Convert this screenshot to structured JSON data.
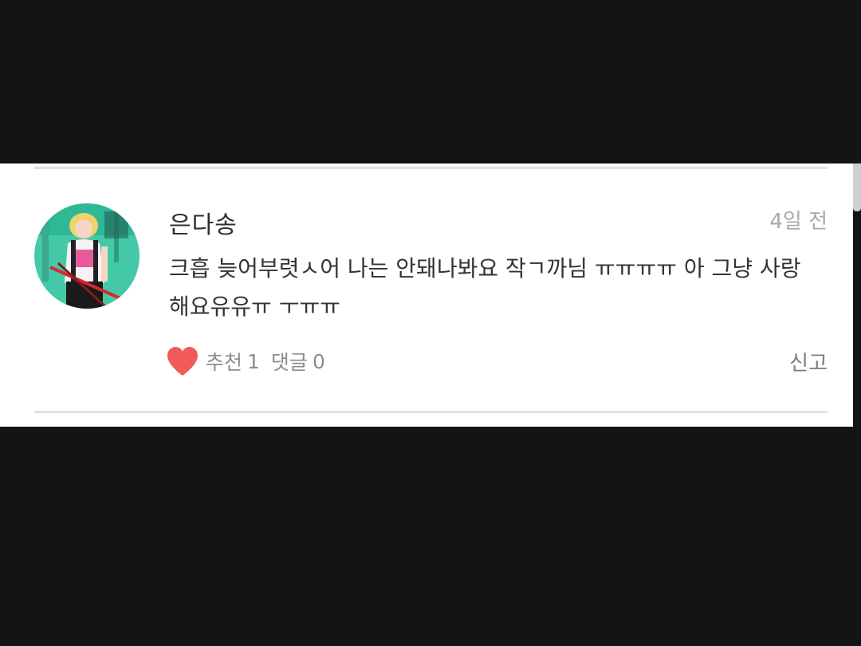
{
  "comment": {
    "username": "은다송",
    "timestamp": "4일 전",
    "text": "크흡 늦어부렷ㅅ어 나는 안돼나봐요 작ㄱ까님 ㅠㅠㅠㅠ 아 그냥 사랑해요유유ㅠ ㅜㅠㅠ",
    "avatar_icon": "user-avatar-photo",
    "like_label": "추천",
    "like_count": "1",
    "reply_label": "댓글",
    "reply_count": "0",
    "report_label": "신고",
    "heart_icon": "heart-icon",
    "heart_color": "#f25a5a"
  }
}
